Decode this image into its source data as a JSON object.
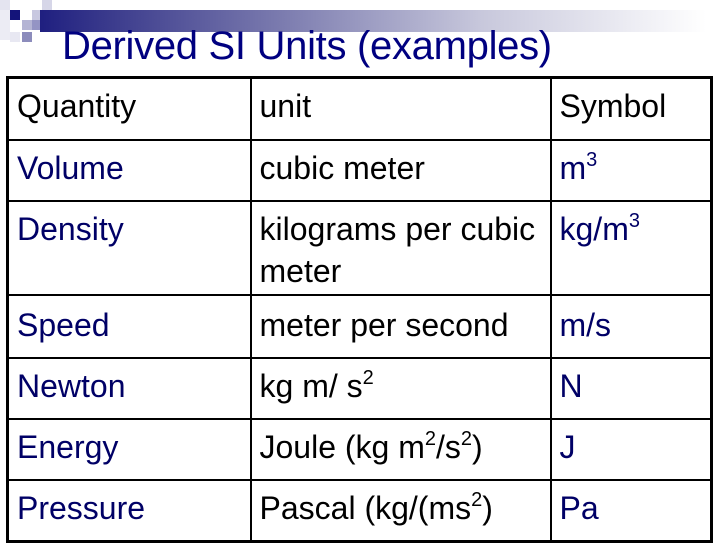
{
  "slide": {
    "title": "Derived SI Units (examples)",
    "colors": {
      "title": "#000080",
      "quantity_text": "#000066",
      "symbol_text": "#000066",
      "unit_text": "#000000",
      "grid": "#000000",
      "decor_dark": "#1a1a80",
      "decor_mid": "#8888c0",
      "decor_light": "#c8c8e0"
    }
  },
  "table": {
    "headers": {
      "quantity": "Quantity",
      "unit": "unit",
      "symbol": "Symbol"
    },
    "rows": [
      {
        "quantity": "Volume",
        "unit": "cubic meter",
        "symbol_base": "m",
        "symbol_sup": "3"
      },
      {
        "quantity": "Density",
        "unit": "kilograms per cubic meter",
        "symbol_base": "kg/m",
        "symbol_sup": "3"
      },
      {
        "quantity": "Speed",
        "unit": "meter per second",
        "symbol_base": "m/s",
        "symbol_sup": ""
      },
      {
        "quantity": "Newton",
        "unit_base": "kg m/ s",
        "unit_sup": "2",
        "symbol_base": "N",
        "symbol_sup": ""
      },
      {
        "quantity": "Energy",
        "unit_parts": [
          "Joule (kg m",
          "2",
          "/s",
          "2",
          ")"
        ],
        "symbol_base": "J",
        "symbol_sup": ""
      },
      {
        "quantity": "Pressure",
        "unit_parts": [
          "Pascal (kg/(ms",
          "2",
          ")"
        ],
        "symbol_base": "Pa",
        "symbol_sup": ""
      }
    ]
  }
}
